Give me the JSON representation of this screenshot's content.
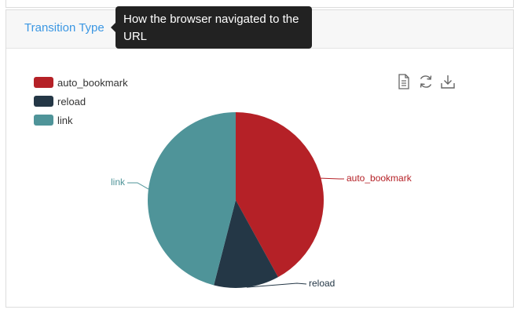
{
  "panel": {
    "title": "Transition Type"
  },
  "tooltip": {
    "text": "How the browser navigated to the URL"
  },
  "toolbox": {
    "icons": [
      "data-view-icon",
      "restore-icon",
      "save-image-icon"
    ]
  },
  "chart_data": {
    "type": "pie",
    "categories": [
      "auto_bookmark",
      "reload",
      "link"
    ],
    "values": [
      42,
      12,
      46
    ],
    "colors": [
      "#b52127",
      "#243746",
      "#4f9499"
    ],
    "legend_position": "top-left"
  }
}
